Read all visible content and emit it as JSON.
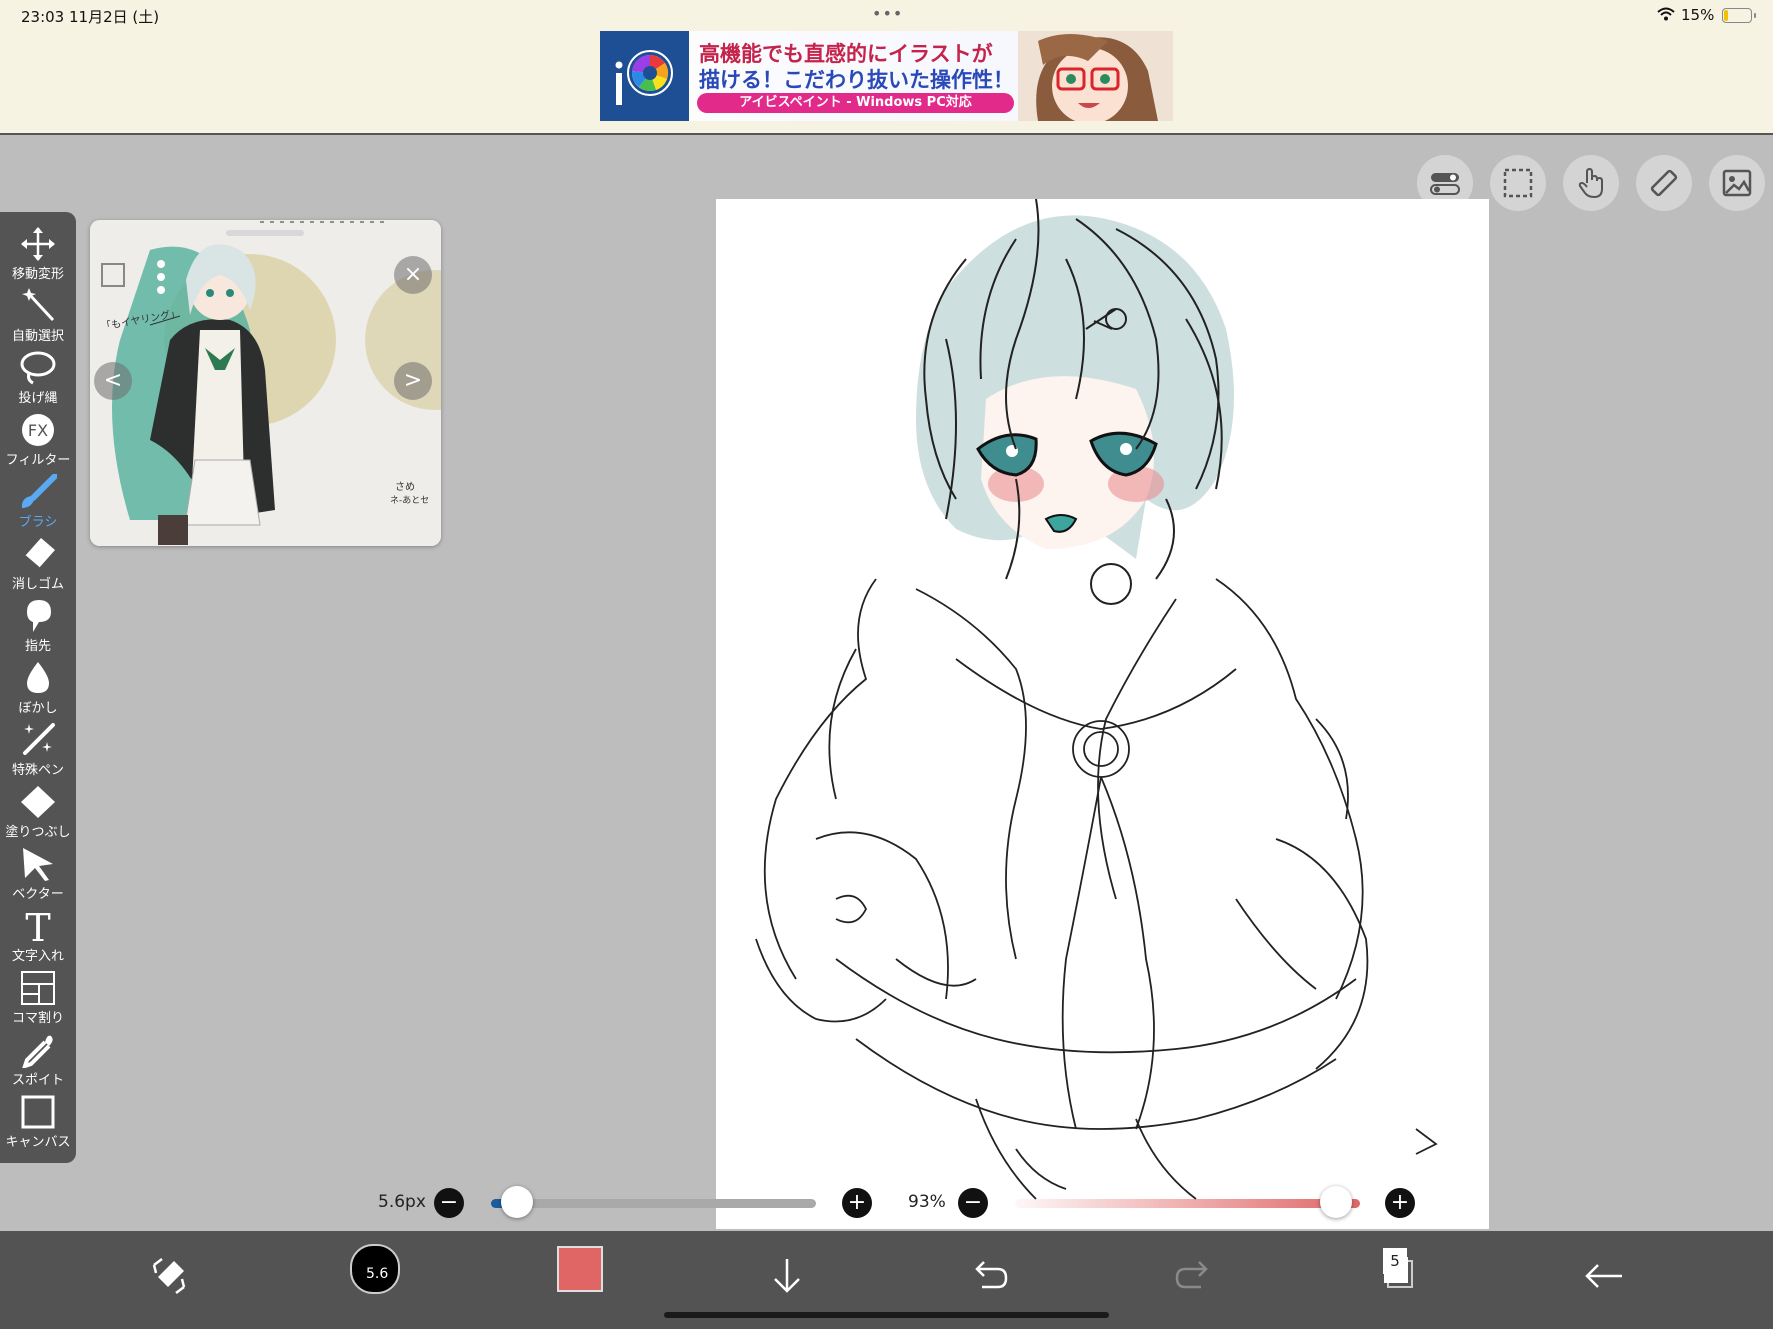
{
  "status_bar": {
    "time": "23:03  11月2日 (土)",
    "battery_percent": "15%",
    "multitask_dots": "•••"
  },
  "ad_banner": {
    "line1": "高機能でも直感的にイラストが",
    "line2": "描ける！こだわり抜いた操作性！",
    "pill": "アイビスペイント - Windows PC対応",
    "logo_text": "iP"
  },
  "tools": [
    {
      "label": "移動変形",
      "icon": "move-transform-icon"
    },
    {
      "label": "自動選択",
      "icon": "magic-wand-icon"
    },
    {
      "label": "投げ縄",
      "icon": "lasso-icon"
    },
    {
      "label": "フィルター",
      "icon": "fx-filter-icon"
    },
    {
      "label": "ブラシ",
      "icon": "brush-icon",
      "active": true
    },
    {
      "label": "消しゴム",
      "icon": "eraser-icon"
    },
    {
      "label": "指先",
      "icon": "smudge-icon"
    },
    {
      "label": "ぼかし",
      "icon": "blur-drop-icon"
    },
    {
      "label": "特殊ペン",
      "icon": "special-pen-icon"
    },
    {
      "label": "塗りつぶし",
      "icon": "fill-bucket-icon"
    },
    {
      "label": "ベクター",
      "icon": "vector-cursor-icon"
    },
    {
      "label": "文字入れ",
      "icon": "text-icon"
    },
    {
      "label": "コマ割り",
      "icon": "frame-divider-icon"
    },
    {
      "label": "スポイト",
      "icon": "eyedropper-icon"
    },
    {
      "label": "キャンバス",
      "icon": "canvas-icon"
    }
  ],
  "reference_window": {
    "prev_glyph": "<",
    "next_glyph": ">",
    "close_glyph": "×"
  },
  "brush_controls": {
    "size_label": "5.6px",
    "size_fraction": 0.08,
    "opacity_label": "93%",
    "opacity_fraction": 0.93,
    "minus_glyph": "−",
    "plus_glyph": "+"
  },
  "bottom_bar": {
    "brush_size_badge": "5.6",
    "layer_count": "5",
    "color": "#e06666"
  },
  "colors": {
    "accent_blue": "#5aa9f3",
    "size_fill": "#1d5c9c",
    "toolbar_bg": "#545454",
    "bottom_bg": "#535353"
  }
}
